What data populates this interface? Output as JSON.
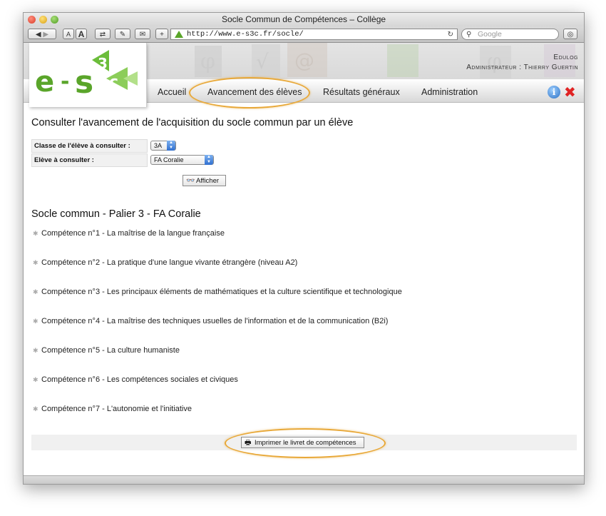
{
  "window": {
    "title": "Socle Commun de Compétences – Collège"
  },
  "browser": {
    "url": "http://www.e-s3c.fr/socle/",
    "search_placeholder": "Google",
    "buttons": {
      "small_a": "A",
      "large_a": "A",
      "add": "+"
    }
  },
  "header": {
    "app_name": "Edulog",
    "user_line": "Administrateur : Thierry Guertin",
    "logo_text": "e-s3c"
  },
  "nav": {
    "items": [
      {
        "label": "Accueil"
      },
      {
        "label": "Avancement des élèves"
      },
      {
        "label": "Résultats généraux"
      },
      {
        "label": "Administration"
      }
    ]
  },
  "page": {
    "heading": "Consulter l'avancement de l'acquisition du socle commun par un élève",
    "form": {
      "class_label": "Classe de l'élève à consulter :",
      "class_value": "3A",
      "student_label": "Elève à consulter :",
      "student_value": "FA Coralie",
      "submit_label": "Afficher"
    },
    "section_title": "Socle commun - Palier 3 - FA Coralie",
    "competences": [
      "Compétence n°1 - La maîtrise de la langue française",
      "Compétence n°2 - La pratique d'une langue vivante étrangère (niveau A2)",
      "Compétence n°3 - Les principaux éléments de mathématiques et la culture scientifique et technologique",
      "Compétence n°4 - La maîtrise des techniques usuelles de l'information et de la communication (B2i)",
      "Compétence n°5 - La culture humaniste",
      "Compétence n°6 - Les compétences sociales et civiques",
      "Compétence n°7 - L'autonomie et l'initiative"
    ],
    "print_label": "Imprimer le livret de compétences"
  },
  "colors": {
    "highlight_ellipse": "#e8a838",
    "logo_green": "#5aa52a"
  }
}
